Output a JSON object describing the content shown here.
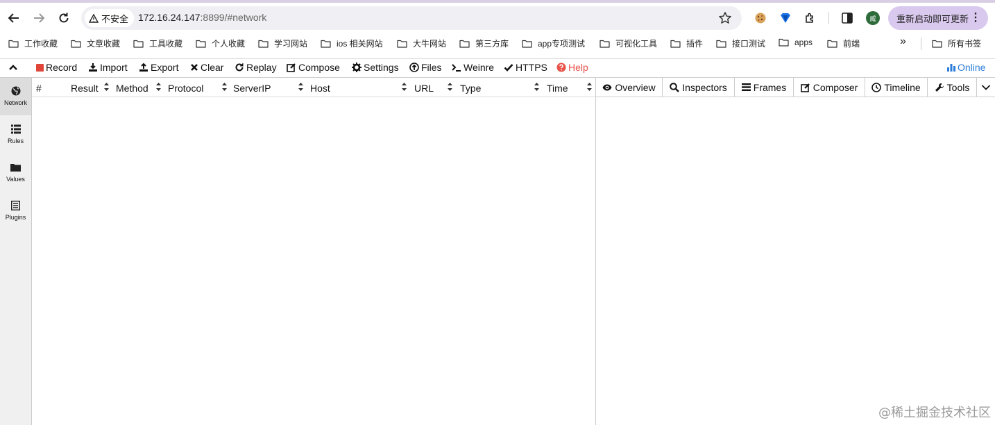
{
  "browser": {
    "security_label": "不安全",
    "url_host": "172.16.24.147",
    "url_path": ":8899/#network",
    "update_button_label": "重新启动即可更新",
    "profile_initial": "威",
    "profile_color": "#2e6b3a",
    "accent_color": "#d9c9ee"
  },
  "bookmarks": {
    "items": [
      "工作收藏",
      "文章收藏",
      "工具收藏",
      "个人收藏",
      "学习网站",
      "ios 相关网站",
      "大牛网站",
      "第三方库",
      "app专项测试",
      "可视化工具",
      "插件",
      "接口测试",
      "apps",
      "前端"
    ],
    "more": "»",
    "all_bookmarks": "所有书签"
  },
  "toolbar": {
    "record": "Record",
    "import": "Import",
    "export": "Export",
    "clear": "Clear",
    "replay": "Replay",
    "compose": "Compose",
    "settings": "Settings",
    "files": "Files",
    "weinre": "Weinre",
    "https": "HTTPS",
    "help": "Help",
    "online": "Online",
    "record_color": "#e0453a",
    "help_color": "#e8524a",
    "online_color": "#2b7dd8"
  },
  "sidebar": {
    "items": [
      {
        "label": "Network",
        "icon": "globe-icon"
      },
      {
        "label": "Rules",
        "icon": "list-icon"
      },
      {
        "label": "Values",
        "icon": "folder-icon"
      },
      {
        "label": "Plugins",
        "icon": "document-icon"
      }
    ]
  },
  "table": {
    "columns": [
      "#",
      "Result",
      "Method",
      "Protocol",
      "ServerIP",
      "Host",
      "URL",
      "Type",
      "Time"
    ]
  },
  "right_tabs": [
    "Overview",
    "Inspectors",
    "Frames",
    "Composer",
    "Timeline",
    "Tools"
  ],
  "watermark": "@稀土掘金技术社区"
}
